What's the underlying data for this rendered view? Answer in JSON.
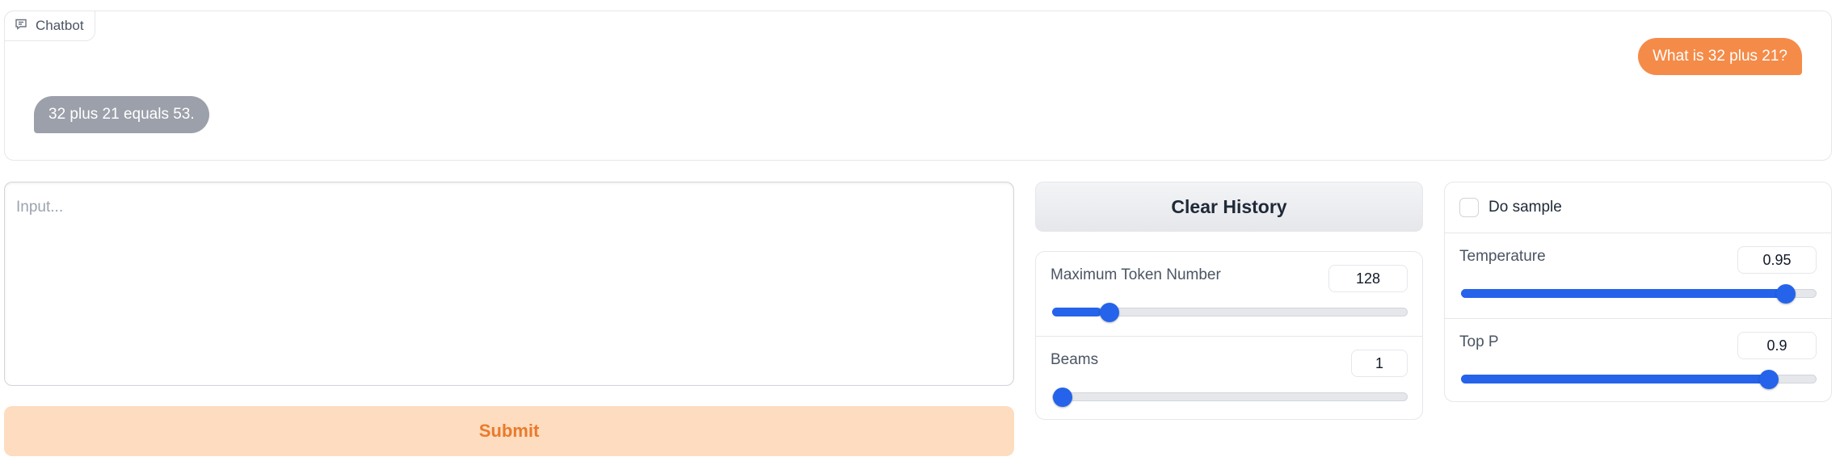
{
  "chatbot": {
    "label": "Chatbot",
    "messages": [
      {
        "role": "user",
        "text": "What is 32 plus 21?"
      },
      {
        "role": "bot",
        "text": "32 plus 21 equals 53."
      }
    ]
  },
  "input": {
    "placeholder": "Input...",
    "value": ""
  },
  "buttons": {
    "submit": "Submit",
    "clear_history": "Clear History"
  },
  "controls": {
    "max_tokens": {
      "label": "Maximum Token Number",
      "value": "128",
      "fill_fraction": 0.14
    },
    "beams": {
      "label": "Beams",
      "value": "1",
      "fill_fraction": 0.0
    },
    "do_sample": {
      "label": "Do sample",
      "checked": false
    },
    "temperature": {
      "label": "Temperature",
      "value": "0.95",
      "fill_fraction": 0.94
    },
    "top_p": {
      "label": "Top P",
      "value": "0.9",
      "fill_fraction": 0.89
    }
  },
  "colors": {
    "user_bubble": "#f58b48",
    "bot_bubble": "#9ca0aa",
    "accent": "#2563eb",
    "submit_bg": "#fddcbf",
    "submit_text": "#ea7a2b"
  }
}
